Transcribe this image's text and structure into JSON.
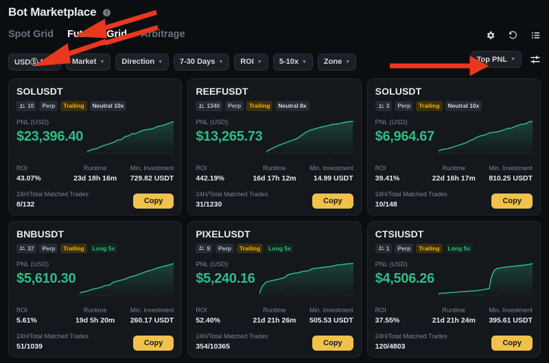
{
  "header": {
    "title": "Bot Marketplace",
    "info_icon": "info-circle-icon"
  },
  "tabs": [
    {
      "label": "Spot Grid",
      "active": false
    },
    {
      "label": "Futures Grid",
      "active": true
    },
    {
      "label": "Arbitrage",
      "active": false
    }
  ],
  "tab_icons": [
    {
      "name": "gear-icon"
    },
    {
      "name": "refresh-icon"
    },
    {
      "name": "list-icon"
    }
  ],
  "filters": [
    {
      "label": "USDⓈ-M",
      "name": "filter-usds-m"
    },
    {
      "label": "Market",
      "name": "filter-market"
    },
    {
      "label": "Direction",
      "name": "filter-direction"
    },
    {
      "label": "7-30 Days",
      "name": "filter-days"
    },
    {
      "label": "ROI",
      "name": "filter-roi"
    },
    {
      "label": "5-10x",
      "name": "filter-leverage"
    },
    {
      "label": "Zone",
      "name": "filter-zone"
    }
  ],
  "sort": {
    "label": "Top PNL",
    "settings_icon": "sliders-icon"
  },
  "card_labels": {
    "pnl": "PNL (USD)",
    "roi": "ROI",
    "runtime": "Runtime",
    "min_investment": "Min. Investment",
    "matched_trades": "24H/Total Matched Trades",
    "copy": "Copy"
  },
  "colors": {
    "accent_yellow": "#f0b90b",
    "copy_button": "#f0c24b",
    "profit_green": "#2ebd85",
    "page_bg": "#0b0e11",
    "card_bg": "#14171c",
    "annotation_red": "#e8381f"
  },
  "cards": [
    {
      "symbol": "SOLUSDT",
      "users": "10",
      "badges": [
        {
          "text": "Perp",
          "style": "plain"
        },
        {
          "text": "Trailing",
          "style": "trailing"
        },
        {
          "text": "Neutral 10x",
          "style": "neutral"
        }
      ],
      "pnl": "$23,396.40",
      "roi": "43.07%",
      "runtime": "23d 18h 16m",
      "min_investment": "729.82 USDT",
      "matched_trades": "8/132",
      "spark": "0,44 12,41 22,40 32,37 42,35 52,33 62,31 70,28 80,27 88,23 96,22 104,19 112,19 122,16 132,14 142,13 152,12 162,9 172,8 182,6 190,4 200,2"
    },
    {
      "symbol": "REEFUSDT",
      "users": "1340",
      "badges": [
        {
          "text": "Perp",
          "style": "plain"
        },
        {
          "text": "Trailing",
          "style": "trailing"
        },
        {
          "text": "Neutral 8x",
          "style": "neutral"
        }
      ],
      "pnl": "$13,265.73",
      "roi": "442.19%",
      "runtime": "16d 17h 12m",
      "min_investment": "14.99 USDT",
      "matched_trades": "31/1230",
      "spark": "0,44 16,39 30,35 44,32 56,29 66,27 74,25 82,21 92,17 102,14 114,12 126,10 140,8 154,6 168,5 182,3 192,2 200,2"
    },
    {
      "symbol": "SOLUSDT",
      "users": "3",
      "badges": [
        {
          "text": "Perp",
          "style": "plain"
        },
        {
          "text": "Trailing",
          "style": "trailing"
        },
        {
          "text": "Neutral 10x",
          "style": "neutral"
        }
      ],
      "pnl": "$6,964.67",
      "roi": "39.41%",
      "runtime": "22d 16h 17m",
      "min_investment": "810.25 USDT",
      "matched_trades": "10/148",
      "spark": "0,43 10,41 20,40 30,38 40,36 48,34 58,32 66,29 74,27 82,24 90,22 98,21 108,18 118,17 128,16 138,14 146,12 156,11 166,8 176,6 186,5 194,2 200,2"
    },
    {
      "symbol": "BNBUSDT",
      "users": "37",
      "badges": [
        {
          "text": "Perp",
          "style": "plain"
        },
        {
          "text": "Trailing",
          "style": "trailing"
        },
        {
          "text": "Long 5x",
          "style": "long"
        }
      ],
      "pnl": "$5,610.30",
      "roi": "5.61%",
      "runtime": "19d 5h 20m",
      "min_investment": "260.17 USDT",
      "matched_trades": "51/1039",
      "spark": "0,43 14,41 28,38 42,36 54,33 64,32 72,28 84,26 96,24 106,21 118,19 130,16 142,13 154,11 166,8 178,6 190,4 200,2"
    },
    {
      "symbol": "PIXELUSDT",
      "users": "9",
      "badges": [
        {
          "text": "Perp",
          "style": "plain"
        },
        {
          "text": "Trailing",
          "style": "trailing"
        },
        {
          "text": "Long 5x",
          "style": "long"
        }
      ],
      "pnl": "$5,240.16",
      "roi": "52.40%",
      "runtime": "21d 21h 26m",
      "min_investment": "505.53 USDT",
      "matched_trades": "354/10365",
      "spark": "0,44 6,34 14,28 26,26 40,24 52,22 60,18 70,16 82,15 92,13 104,12 114,9 126,8 140,7 152,6 166,4 180,3 192,2 200,2"
    },
    {
      "symbol": "CTSIUSDT",
      "users": "1",
      "badges": [
        {
          "text": "Perp",
          "style": "plain"
        },
        {
          "text": "Trailing",
          "style": "trailing"
        },
        {
          "text": "Long 5x",
          "style": "long"
        }
      ],
      "pnl": "$4,506.26",
      "roi": "37.55%",
      "runtime": "21d 21h 24m",
      "min_investment": "395.61 USDT",
      "matched_trades": "120/4803",
      "spark": "0,44 20,43 40,42 60,41 80,40 92,39 100,38 108,37 112,22 118,12 124,9 132,8 142,7 156,6 170,5 184,4 194,3 200,2"
    }
  ],
  "annotations": [
    {
      "name": "arrow-to-futures-grid-tab"
    },
    {
      "name": "arrow-to-arbitrage-tab"
    },
    {
      "name": "arrow-to-usds-m-filter"
    },
    {
      "name": "arrow-to-top-pnl-sort"
    }
  ]
}
